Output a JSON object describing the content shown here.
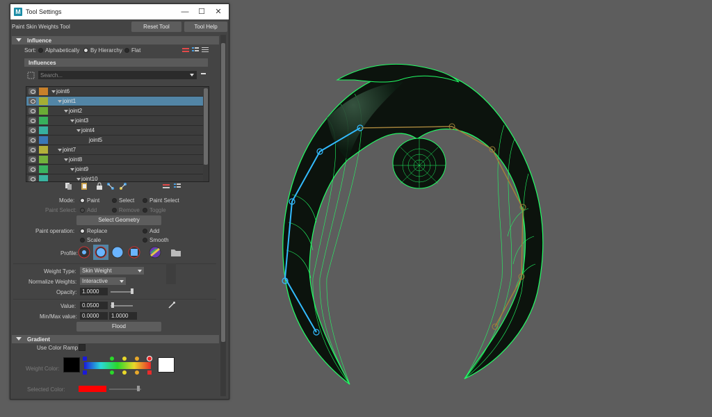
{
  "window": {
    "title": "Tool Settings",
    "tool_name": "Paint Skin Weights Tool",
    "reset_button": "Reset Tool",
    "help_button": "Tool Help",
    "minimize": "—",
    "maximize": "☐",
    "close": "✕"
  },
  "influence": {
    "header": "Influence",
    "sort_label": "Sort:",
    "sort_options": [
      "Alphabetically",
      "By Hierarchy",
      "Flat"
    ],
    "sort_selected": "By Hierarchy",
    "influences_header": "Influences",
    "search_placeholder": "Search...",
    "joints": [
      {
        "name": "joint6",
        "color": "#c8802a",
        "selected": false
      },
      {
        "name": "joint1",
        "color": "#a4ae34",
        "selected": true
      },
      {
        "name": "joint2",
        "color": "#6aab35",
        "selected": false
      },
      {
        "name": "joint3",
        "color": "#37b05c",
        "selected": false
      },
      {
        "name": "joint4",
        "color": "#37b0a0",
        "selected": false
      },
      {
        "name": "joint5",
        "color": "#3a77b8",
        "selected": false
      },
      {
        "name": "joint7",
        "color": "#b4b03a",
        "selected": false
      },
      {
        "name": "joint8",
        "color": "#73b13c",
        "selected": false
      },
      {
        "name": "joint9",
        "color": "#3ab35f",
        "selected": false
      },
      {
        "name": "joint10",
        "color": "#3ab3a0",
        "selected": false
      }
    ]
  },
  "mode": {
    "label": "Mode:",
    "options": [
      "Paint",
      "Select",
      "Paint Select"
    ],
    "selected": "Paint",
    "paint_select_label": "Paint Select:",
    "paint_select_options": [
      "Add",
      "Remove",
      "Toggle"
    ],
    "select_geometry_button": "Select Geometry"
  },
  "paint_operation": {
    "label": "Paint operation:",
    "options": [
      "Replace",
      "Add",
      "Scale",
      "Smooth"
    ],
    "selected": "Replace"
  },
  "profile": {
    "label": "Profile:"
  },
  "weights": {
    "weight_type_label": "Weight Type:",
    "weight_type_value": "Skin Weight",
    "normalize_label": "Normalize Weights:",
    "normalize_value": "Interactive",
    "opacity_label": "Opacity:",
    "opacity_value": "1.0000",
    "value_label": "Value:",
    "value_value": "0.0500",
    "minmax_label": "Min/Max value:",
    "min_value": "0.0000",
    "max_value": "1.0000",
    "flood_button": "Flood"
  },
  "gradient": {
    "header": "Gradient",
    "use_color_ramp_label": "Use Color Ramp",
    "weight_color_label": "Weight Color:",
    "selected_color_label": "Selected Color:",
    "selected_color": "#ff0000"
  },
  "colors": {
    "wireframe": "#22ff66",
    "joint": "#33bbff",
    "selected_row": "#5285a6"
  }
}
